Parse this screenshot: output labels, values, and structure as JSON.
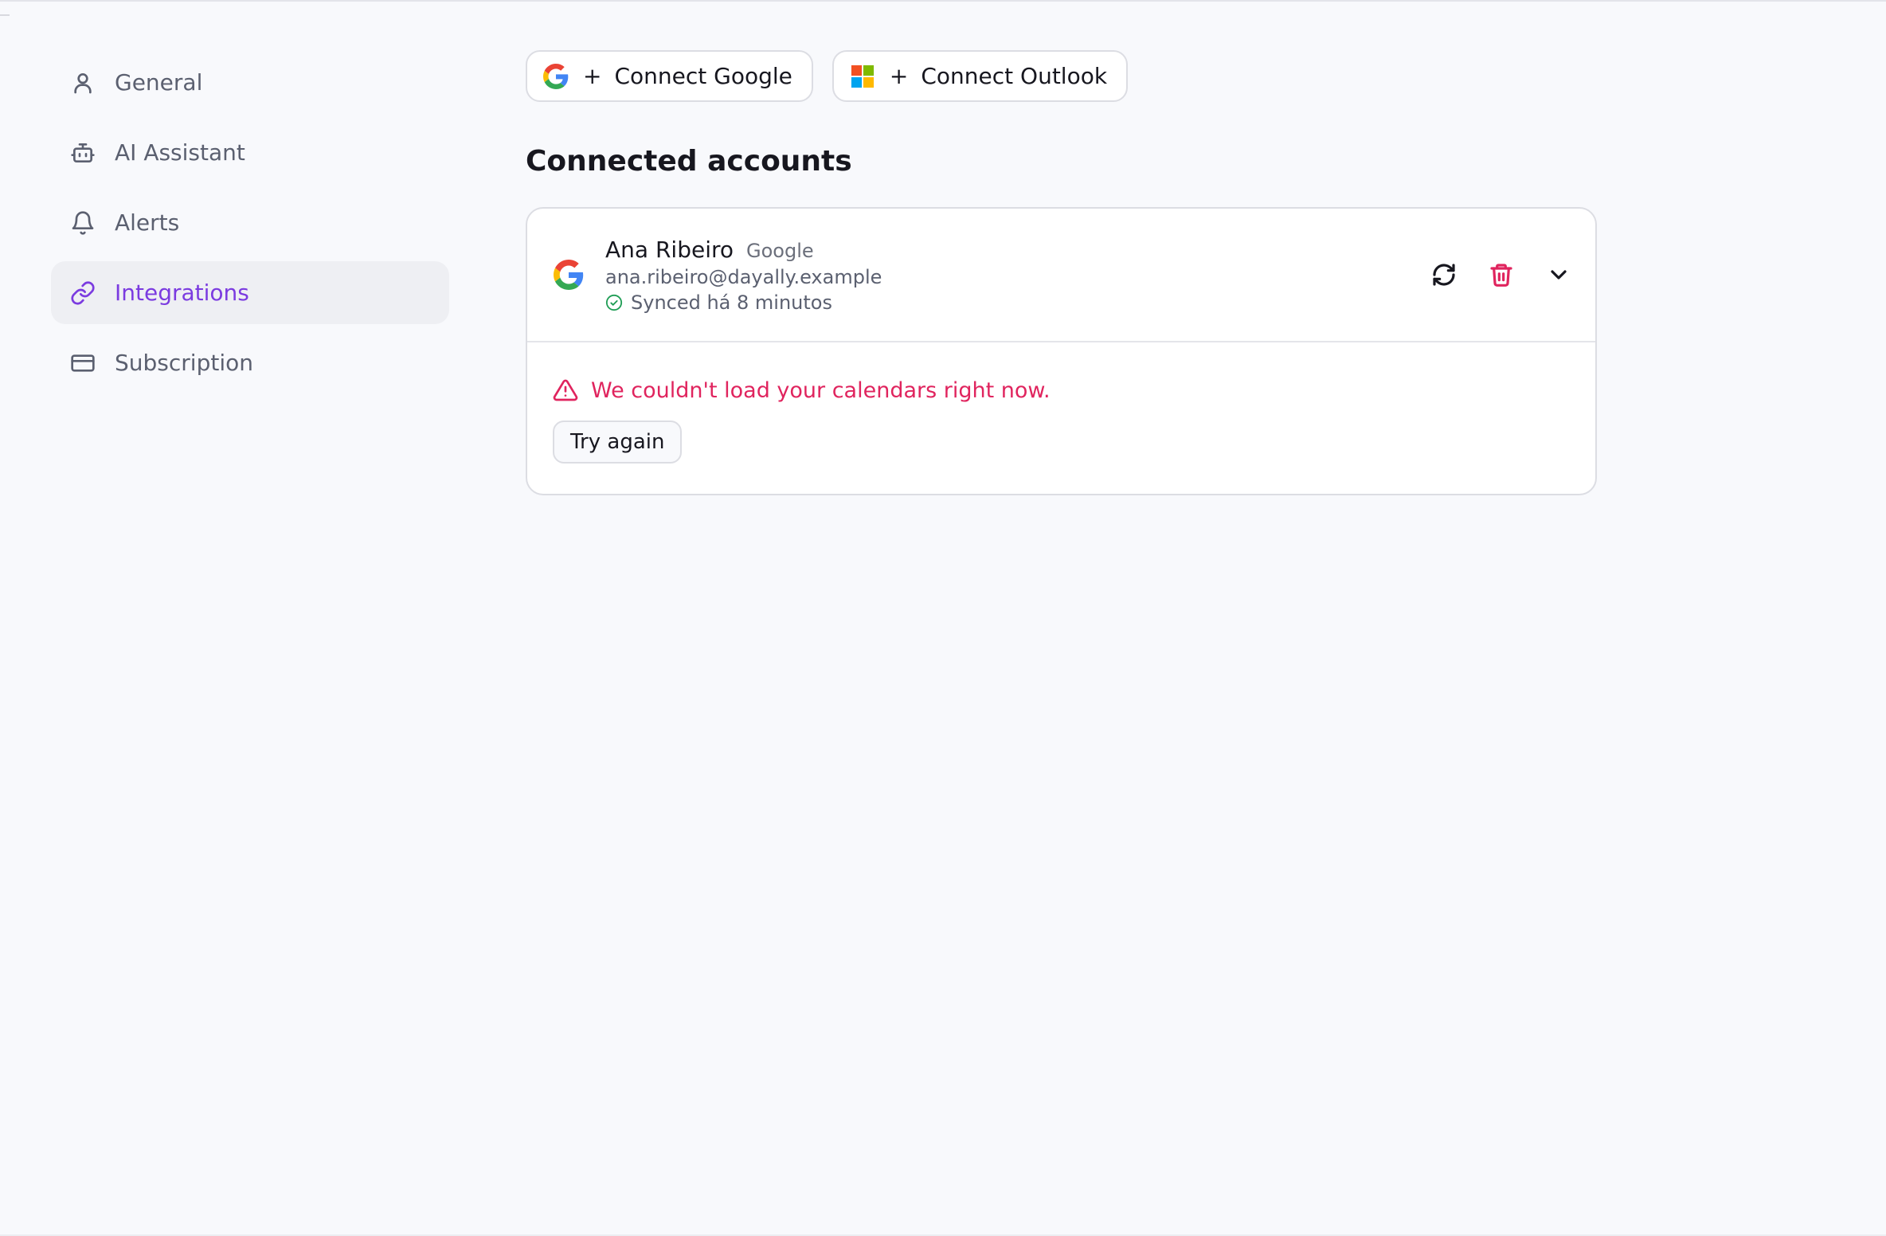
{
  "sidebar": {
    "items": [
      {
        "label": "General",
        "icon": "user-icon",
        "active": false
      },
      {
        "label": "AI Assistant",
        "icon": "robot-icon",
        "active": false
      },
      {
        "label": "Alerts",
        "icon": "bell-icon",
        "active": false
      },
      {
        "label": "Integrations",
        "icon": "link-icon",
        "active": true
      },
      {
        "label": "Subscription",
        "icon": "credit-card-icon",
        "active": false
      }
    ]
  },
  "connect": {
    "google_label": "Connect Google",
    "outlook_label": "Connect Outlook",
    "plus": "+"
  },
  "connected": {
    "title": "Connected accounts",
    "account": {
      "name": "Ana Ribeiro",
      "provider": "Google",
      "email": "ana.ribeiro@dayally.example",
      "sync_status": "Synced há 8 minutos"
    },
    "error_message": "We couldn't load your calendars right now.",
    "retry_label": "Try again"
  },
  "colors": {
    "accent": "#7b3be0",
    "danger": "#e0245e",
    "success": "#1f9d55",
    "background": "#f8f9fc"
  }
}
